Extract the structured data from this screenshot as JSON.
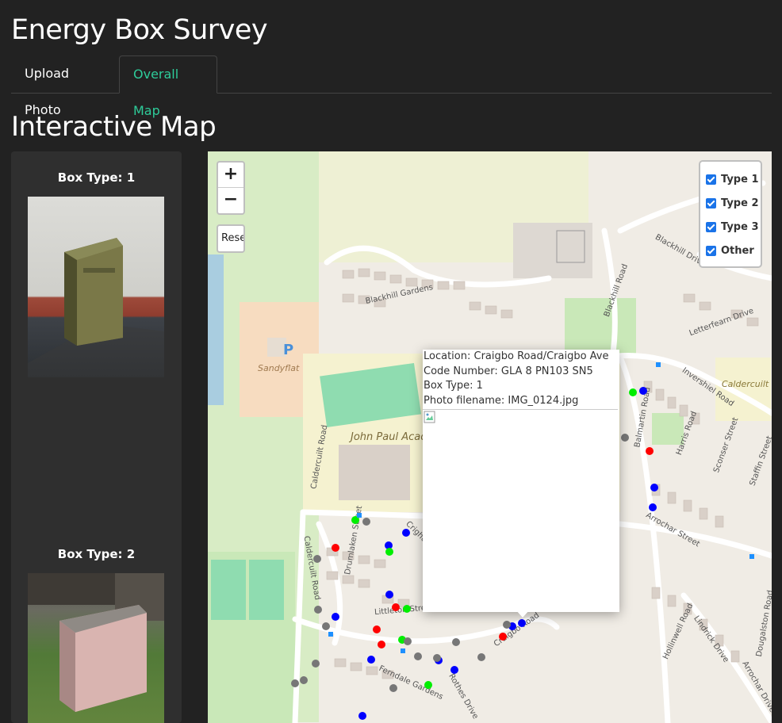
{
  "header": {
    "title": "Energy Box Survey"
  },
  "tabs": [
    {
      "label": "Upload Photo",
      "active": false
    },
    {
      "label": "Overall Map",
      "active": true
    }
  ],
  "section": {
    "title": "Interactive Map"
  },
  "sidebar": {
    "boxes": [
      {
        "label": "Box Type: 1"
      },
      {
        "label": "Box Type: 2"
      }
    ]
  },
  "map": {
    "zoom_in": "+",
    "zoom_out": "−",
    "reset": "Reset",
    "layers": [
      {
        "label": "Type 1",
        "checked": true
      },
      {
        "label": "Type 2",
        "checked": true
      },
      {
        "label": "Type 3",
        "checked": true
      },
      {
        "label": "Other",
        "checked": true
      }
    ],
    "popup": {
      "location": "Location: Craigbo Road/Craigbo Ave",
      "code": "Code Number: GLA 8 PN103 SN5",
      "box_type": "Box Type: 1",
      "photo": "Photo filename: IMG_0124.jpg"
    },
    "labels": {
      "blackhill_gardens": "Blackhill Gardens",
      "blackhill_drive": "Blackhill Drive",
      "blackhill_road": "Blackhill Road",
      "letterfearn": "Letterfearn Drive",
      "sandyflat": "Sandyflat",
      "caldercuilt_road": "Caldercuilt Road",
      "caldercuilt_school": "Caldercuilt Primary School",
      "john_paul": "John Paul Academy",
      "invershiel": "Invershiel Road",
      "balmartin": "Balmartin Road",
      "harris": "Harris Road",
      "sconser": "Sconser Street",
      "staffin": "Staffin Street",
      "arrochar_street": "Arrochar Street",
      "arrochar_drive": "Arrochar Drive",
      "drumlaken": "Drumlaken Street",
      "littleton": "Littleton Street",
      "craigbo_road": "Craigbo Road",
      "rothes": "Rothes Drive",
      "ferndale": "Ferndale Gardens",
      "hollinwell": "Hollinwell Road",
      "lindrick": "Lindrick Drive",
      "dougalston": "Dougalston Road",
      "crighton": "Crighton Street",
      "parking": "P"
    },
    "marker_colors": {
      "type1": "#0000ff",
      "type2": "#ff0000",
      "type3": "#00ee00",
      "other": "#777777"
    }
  }
}
